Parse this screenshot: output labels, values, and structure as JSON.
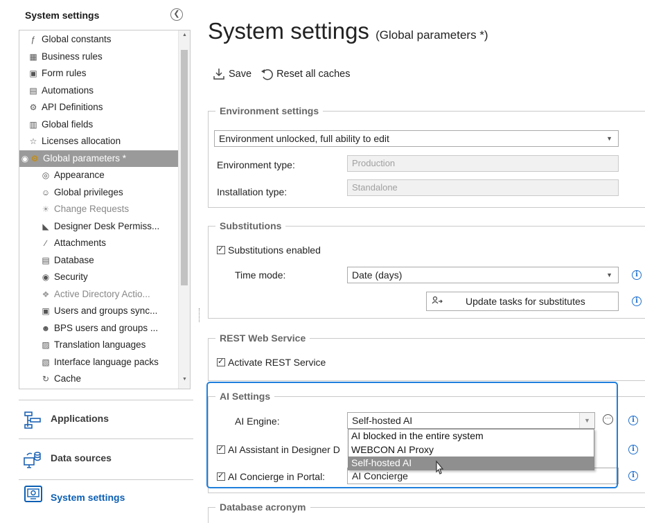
{
  "sidebar": {
    "title": "System settings",
    "tree": [
      {
        "label": "Global constants",
        "icon": "function-icon"
      },
      {
        "label": "Business rules",
        "icon": "rules-icon"
      },
      {
        "label": "Form rules",
        "icon": "form-rules-icon"
      },
      {
        "label": "Automations",
        "icon": "automation-icon"
      },
      {
        "label": "API Definitions",
        "icon": "api-icon"
      },
      {
        "label": "Global fields",
        "icon": "fields-icon"
      },
      {
        "label": "Licenses allocation",
        "icon": "license-icon"
      },
      {
        "label": "Global parameters *",
        "icon": "gear-icon"
      },
      {
        "label": "Appearance",
        "icon": "palette-icon"
      },
      {
        "label": "Global privileges",
        "icon": "users-icon"
      },
      {
        "label": "Change Requests",
        "icon": "lightbulb-icon"
      },
      {
        "label": "Designer Desk Permiss...",
        "icon": "designer-icon"
      },
      {
        "label": "Attachments",
        "icon": "paperclip-icon"
      },
      {
        "label": "Database",
        "icon": "database-icon"
      },
      {
        "label": "Security",
        "icon": "shield-icon"
      },
      {
        "label": "Active Directory Actio...",
        "icon": "directory-icon"
      },
      {
        "label": "Users and groups sync...",
        "icon": "sync-icon"
      },
      {
        "label": "BPS users and groups ...",
        "icon": "group-icon"
      },
      {
        "label": "Translation languages",
        "icon": "translate-icon"
      },
      {
        "label": "Interface language packs",
        "icon": "language-pack-icon"
      },
      {
        "label": "Cache",
        "icon": "refresh-icon"
      }
    ],
    "nav": [
      {
        "label": "Applications",
        "icon": "applications-icon"
      },
      {
        "label": "Data sources",
        "icon": "data-sources-icon"
      },
      {
        "label": "System settings",
        "icon": "system-settings-icon"
      }
    ]
  },
  "main": {
    "title": "System settings",
    "subtitle": "(Global parameters *)",
    "toolbar": {
      "save": "Save",
      "reset": "Reset all caches"
    },
    "environment": {
      "title": "Environment settings",
      "mode": "Environment unlocked, full ability to edit",
      "type_label": "Environment type:",
      "type_value": "Production",
      "install_label": "Installation type:",
      "install_value": "Standalone"
    },
    "substitutions": {
      "title": "Substitutions",
      "enabled_label": "Substitutions enabled",
      "time_label": "Time mode:",
      "time_value": "Date (days)",
      "update_button": "Update tasks for substitutes"
    },
    "rest": {
      "title": "REST Web Service",
      "activate_label": "Activate REST Service"
    },
    "ai": {
      "title": "AI Settings",
      "engine_label": "AI Engine:",
      "engine_value": "Self-hosted AI",
      "assistant_label": "AI Assistant in Designer D",
      "concierge_label": "AI Concierge in Portal:",
      "concierge_value": "AI Concierge",
      "options": [
        "AI blocked in the entire system",
        "WEBCON AI Proxy",
        "Self-hosted AI"
      ],
      "selected_option": 2
    },
    "database": {
      "title": "Database acronym"
    }
  },
  "colors": {
    "accent": "#1e7fdc",
    "selection": "#9a9a9a",
    "info": "#1d6fd0"
  }
}
